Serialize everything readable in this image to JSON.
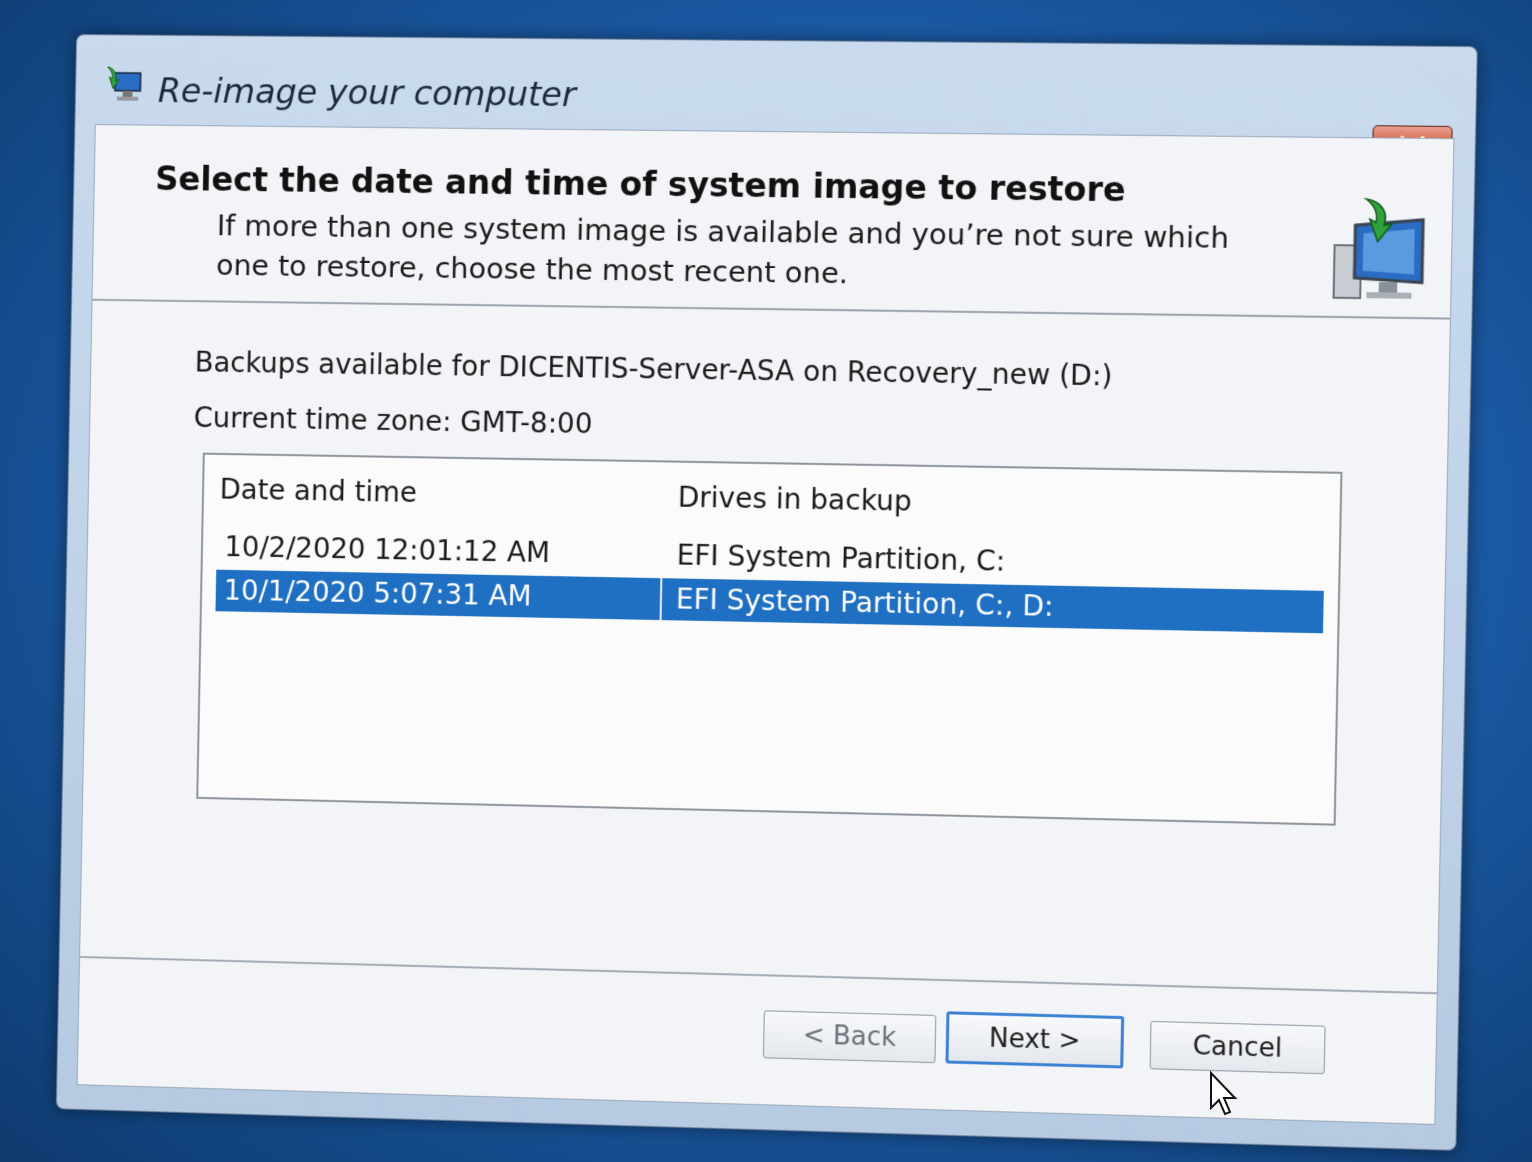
{
  "window": {
    "title": "Re-image your computer",
    "close_label": "X"
  },
  "header": {
    "heading": "Select the date and time of system image to restore",
    "subtext": "If more than one system image is available and you’re not sure which one to restore, choose the most recent one."
  },
  "info": {
    "backups_line": "Backups available for DICENTIS-Server-ASA on Recovery_new (D:)",
    "timezone_line": "Current time zone: GMT-8:00"
  },
  "table": {
    "columns": [
      "Date and time",
      "Drives in backup"
    ],
    "rows": [
      {
        "date": "10/2/2020 12:01:12 AM",
        "drives": "EFI System Partition, C:"
      },
      {
        "date": "10/1/2020 5:07:31 AM",
        "drives": "EFI System Partition, C:, D:"
      }
    ],
    "selected_row": 1
  },
  "buttons": {
    "back": "< Back",
    "next": "Next >",
    "cancel": "Cancel"
  },
  "colors": {
    "selection": "#1f6fc2",
    "close_button": "#c6523a",
    "desktop": "#1d5fae"
  }
}
